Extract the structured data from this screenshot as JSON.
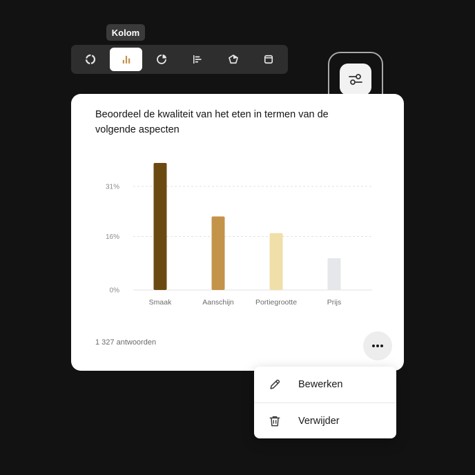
{
  "tooltip": {
    "label": "Kolom"
  },
  "toolbar": {
    "tools": [
      {
        "icon": "donut-chart-icon",
        "active": false
      },
      {
        "icon": "column-chart-icon",
        "active": true
      },
      {
        "icon": "pie-chart-icon",
        "active": false
      },
      {
        "icon": "bar-chart-icon",
        "active": false
      },
      {
        "icon": "polygon-chart-icon",
        "active": false
      },
      {
        "icon": "card-view-icon",
        "active": false
      }
    ]
  },
  "settings": {
    "icon": "sliders-icon"
  },
  "card": {
    "title": "Beoordeel de kwaliteit van het eten in termen van de volgende aspecten",
    "responses": "1 327 antwoorden",
    "more_icon": "more-dots-icon"
  },
  "chart_data": {
    "type": "bar",
    "title": "Beoordeel de kwaliteit van het eten in termen van de volgende aspecten",
    "categories": [
      "Smaak",
      "Aanschijn",
      "Portiegrootte",
      "Prijs"
    ],
    "values": [
      38,
      22,
      17,
      9.5
    ],
    "colors": [
      "#6b4a12",
      "#c4934a",
      "#f0dfa9",
      "#e5e7ea"
    ],
    "ylim": [
      0,
      38
    ],
    "yticks": [
      {
        "value": 0,
        "label": "0%"
      },
      {
        "value": 16,
        "label": "16%"
      },
      {
        "value": 31,
        "label": "31%"
      }
    ],
    "grid": true,
    "xlabel": "",
    "ylabel": ""
  },
  "menu": {
    "items": [
      {
        "label": "Bewerken",
        "icon": "pencil-icon"
      },
      {
        "label": "Verwijder",
        "icon": "trash-icon"
      }
    ]
  },
  "colors": {
    "accent": "#c4934a",
    "background": "#121212"
  }
}
